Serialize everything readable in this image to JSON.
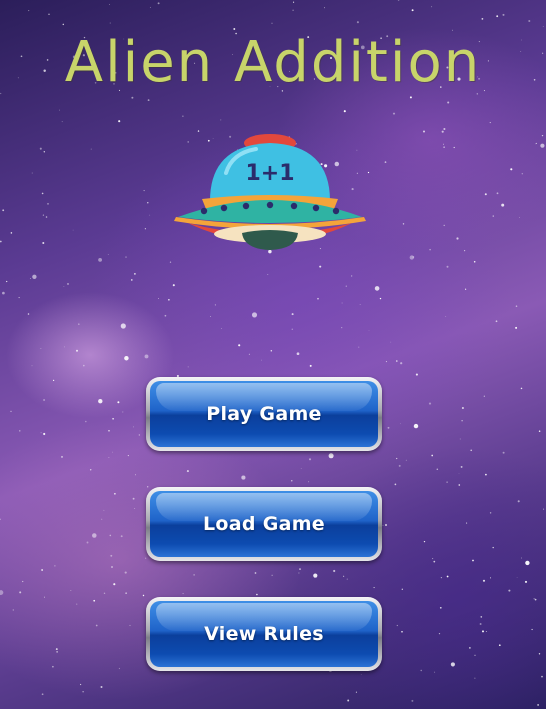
{
  "title": "Alien Addition",
  "ufo": {
    "label": "1+1",
    "colors": {
      "dome": "#3fc0e3",
      "cap": "#e2483c",
      "rim": "#2fb3a3",
      "lights": "#f4a43a",
      "underside": "#e2483c",
      "beam": "#2f5a4c"
    }
  },
  "menu": {
    "play_label": "Play Game",
    "load_label": "Load Game",
    "rules_label": "View Rules"
  },
  "colors": {
    "title": "#c8d46a",
    "button_blue": "#1f63c9",
    "button_bezel": "#a9aab2"
  }
}
